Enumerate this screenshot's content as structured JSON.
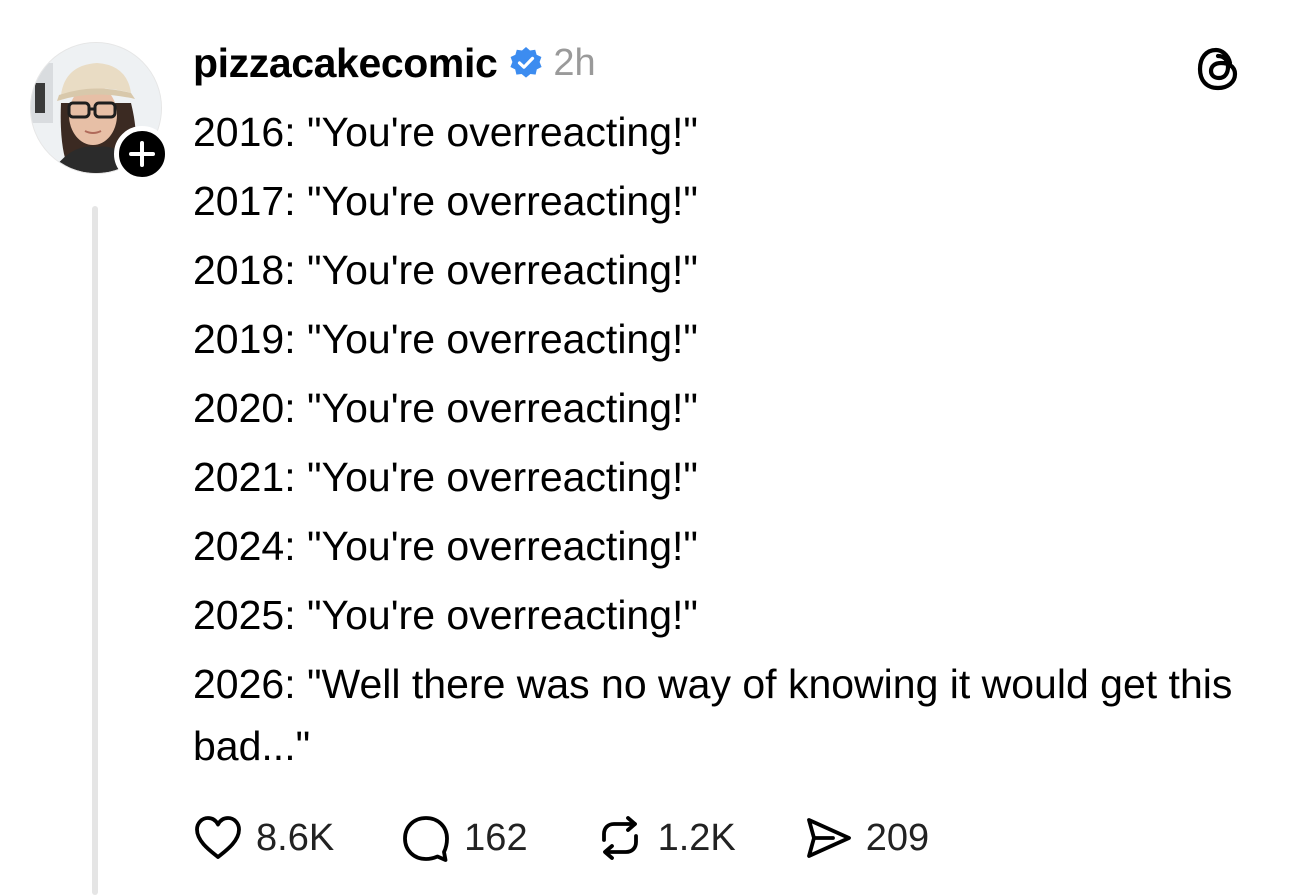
{
  "post": {
    "username": "pizzacakecomic",
    "verified": true,
    "timestamp": "2h",
    "lines": [
      "2016: \"You're overreacting!\"",
      "2017: \"You're overreacting!\"",
      "2018: \"You're overreacting!\"",
      "2019: \"You're overreacting!\"",
      "2020: \"You're overreacting!\"",
      "2021: \"You're overreacting!\"",
      "2024: \"You're overreacting!\"",
      "2025: \"You're overreacting!\"",
      "2026: \"Well there was no way of knowing it would get this bad...\""
    ]
  },
  "actions": {
    "likes": "8.6K",
    "replies": "162",
    "reposts": "1.2K",
    "shares": "209"
  },
  "icons": {
    "verified": "verified-badge-icon",
    "app_logo": "threads-logo-icon",
    "follow": "plus-icon",
    "like": "heart-icon",
    "reply": "comment-icon",
    "repost": "repost-icon",
    "share": "send-icon"
  },
  "colors": {
    "verified_blue": "#3c8cf0",
    "muted_text": "#9a9a9a",
    "thread_line": "#e5e5e5"
  }
}
